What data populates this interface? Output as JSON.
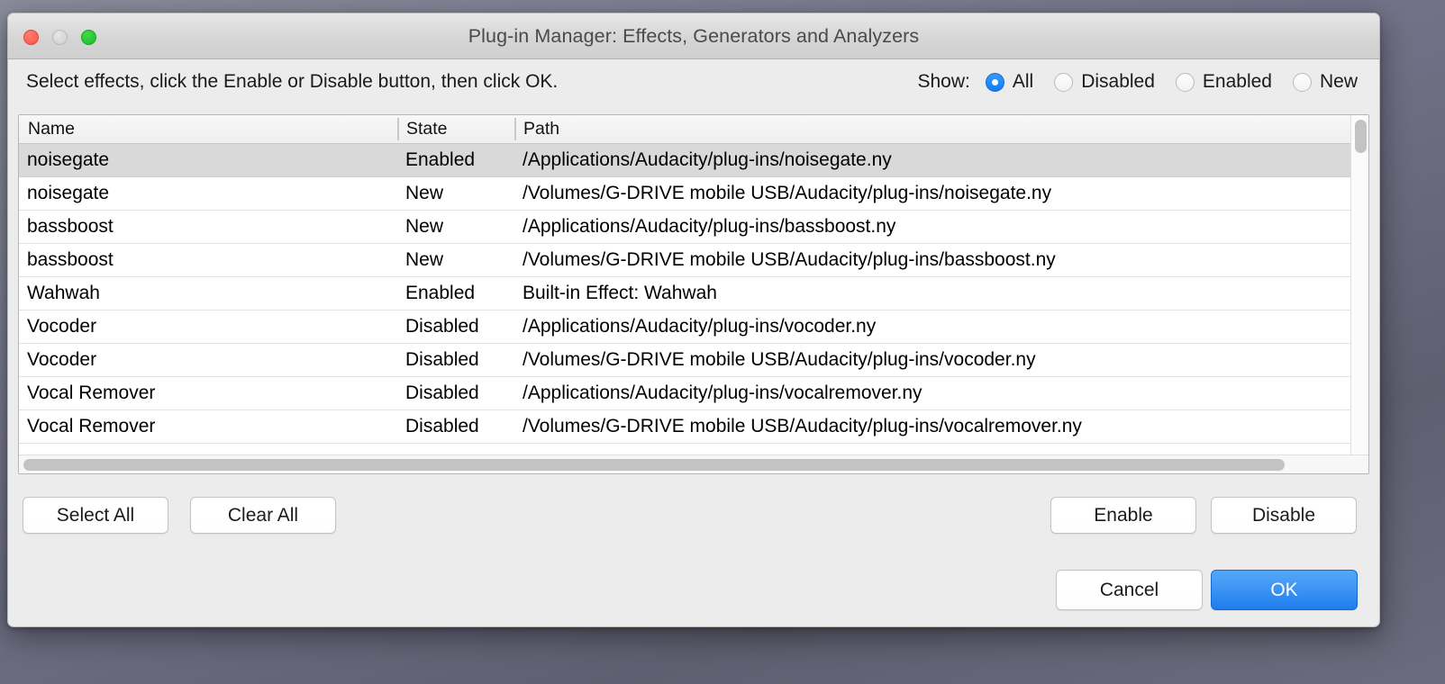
{
  "window": {
    "title": "Plug-in Manager: Effects, Generators and Analyzers",
    "traffic_lights": {
      "close": "close-button",
      "minimize": "minimize-button",
      "maximize": "maximize-button"
    }
  },
  "toolbar": {
    "instruction": "Select effects, click the Enable or Disable button, then click OK.",
    "show_label": "Show:",
    "filters": [
      {
        "label": "All",
        "selected": true
      },
      {
        "label": "Disabled",
        "selected": false
      },
      {
        "label": "Enabled",
        "selected": false
      },
      {
        "label": "New",
        "selected": false
      }
    ],
    "accent_color": "#1f7bf0"
  },
  "table": {
    "columns": [
      "Name",
      "State",
      "Path"
    ],
    "rows": [
      {
        "name": "noisegate",
        "state": "Enabled",
        "path": "/Applications/Audacity/plug-ins/noisegate.ny",
        "selected": true
      },
      {
        "name": "noisegate",
        "state": "New",
        "path": "/Volumes/G-DRIVE mobile USB/Audacity/plug-ins/noisegate.ny",
        "selected": false
      },
      {
        "name": "bassboost",
        "state": "New",
        "path": "/Applications/Audacity/plug-ins/bassboost.ny",
        "selected": false
      },
      {
        "name": "bassboost",
        "state": "New",
        "path": "/Volumes/G-DRIVE mobile USB/Audacity/plug-ins/bassboost.ny",
        "selected": false
      },
      {
        "name": "Wahwah",
        "state": "Enabled",
        "path": "Built-in Effect: Wahwah",
        "selected": false
      },
      {
        "name": "Vocoder",
        "state": "Disabled",
        "path": "/Applications/Audacity/plug-ins/vocoder.ny",
        "selected": false
      },
      {
        "name": "Vocoder",
        "state": "Disabled",
        "path": "/Volumes/G-DRIVE mobile USB/Audacity/plug-ins/vocoder.ny",
        "selected": false
      },
      {
        "name": "Vocal Remover",
        "state": "Disabled",
        "path": "/Applications/Audacity/plug-ins/vocalremover.ny",
        "selected": false
      },
      {
        "name": "Vocal Remover",
        "state": "Disabled",
        "path": "/Volumes/G-DRIVE mobile USB/Audacity/plug-ins/vocalremover.ny",
        "selected": false
      }
    ]
  },
  "buttons": {
    "select_all": "Select All",
    "clear_all": "Clear All",
    "enable": "Enable",
    "disable": "Disable",
    "cancel": "Cancel",
    "ok": "OK"
  }
}
